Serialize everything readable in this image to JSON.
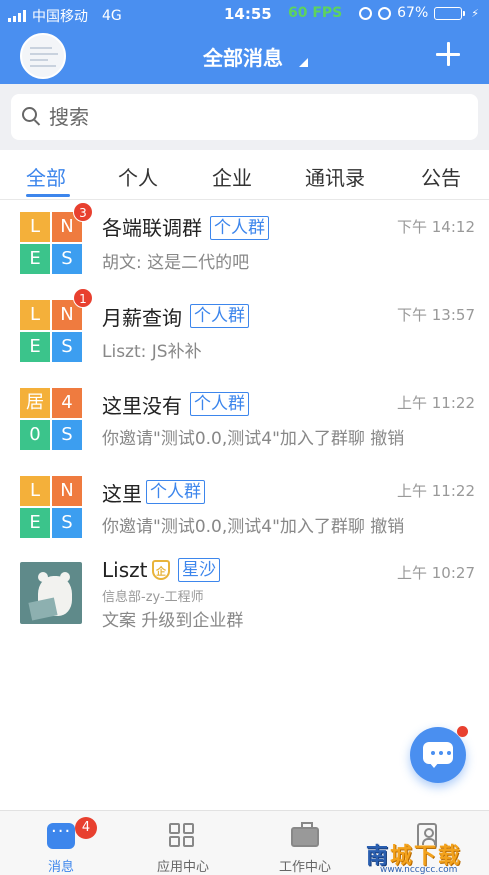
{
  "status_bar": {
    "carrier": "中国移动",
    "network": "4G",
    "time": "14:55",
    "fps": "60 FPS",
    "battery": "67%",
    "battery_level": 0.67
  },
  "nav": {
    "title": "全部消息",
    "add_icon": "plus-icon"
  },
  "search": {
    "placeholder": "搜索"
  },
  "tabs": [
    {
      "label": "全部",
      "active": true
    },
    {
      "label": "个人",
      "active": false
    },
    {
      "label": "企业",
      "active": false
    },
    {
      "label": "通讯录",
      "active": false
    },
    {
      "label": "公告",
      "active": false
    }
  ],
  "conversations": [
    {
      "tiles": [
        "L",
        "N",
        "E",
        "S"
      ],
      "badge": "3",
      "name": "各端联调群",
      "tag": "个人群",
      "time": "下午 14:12",
      "message": "胡文: 这是二代的吧"
    },
    {
      "tiles": [
        "L",
        "N",
        "E",
        "S"
      ],
      "badge": "1",
      "name": "月薪查询",
      "tag": "个人群",
      "time": "下午 13:57",
      "message": "Liszt: JS补补"
    },
    {
      "tiles": [
        "居",
        "4",
        "0",
        "S"
      ],
      "name": "这里没有",
      "tag": "个人群",
      "time": "上午 11:22",
      "message": "你邀请\"测试0.0,测试4\"加入了群聊 撤销"
    },
    {
      "tiles": [
        "L",
        "N",
        "E",
        "S"
      ],
      "name": "这里",
      "tag": "个人群",
      "time": "上午 11:22",
      "message": "你邀请\"测试0.0,测试4\"加入了群聊 撤销"
    },
    {
      "name": "Liszt",
      "shield_glyph": "企",
      "tag": "星沙",
      "time": "上午 10:27",
      "subtitle": "信息部-zy-工程师",
      "message": "文案   升级到企业群"
    }
  ],
  "bottom_nav": [
    {
      "label": "消息",
      "icon": "message-icon",
      "badge": "4",
      "active": true
    },
    {
      "label": "应用中心",
      "icon": "apps-icon",
      "active": false
    },
    {
      "label": "工作中心",
      "icon": "briefcase-icon",
      "active": false
    },
    {
      "label": "",
      "icon": "contacts-icon",
      "active": false
    }
  ],
  "watermark": {
    "text_first": "南",
    "text_rest": "城下载",
    "sub": "www.nccgcc.com"
  },
  "colors": {
    "primary": "#4a8ff0",
    "accent": "#3d86ec",
    "badge": "#e8402f",
    "fps": "#5dd35d"
  }
}
